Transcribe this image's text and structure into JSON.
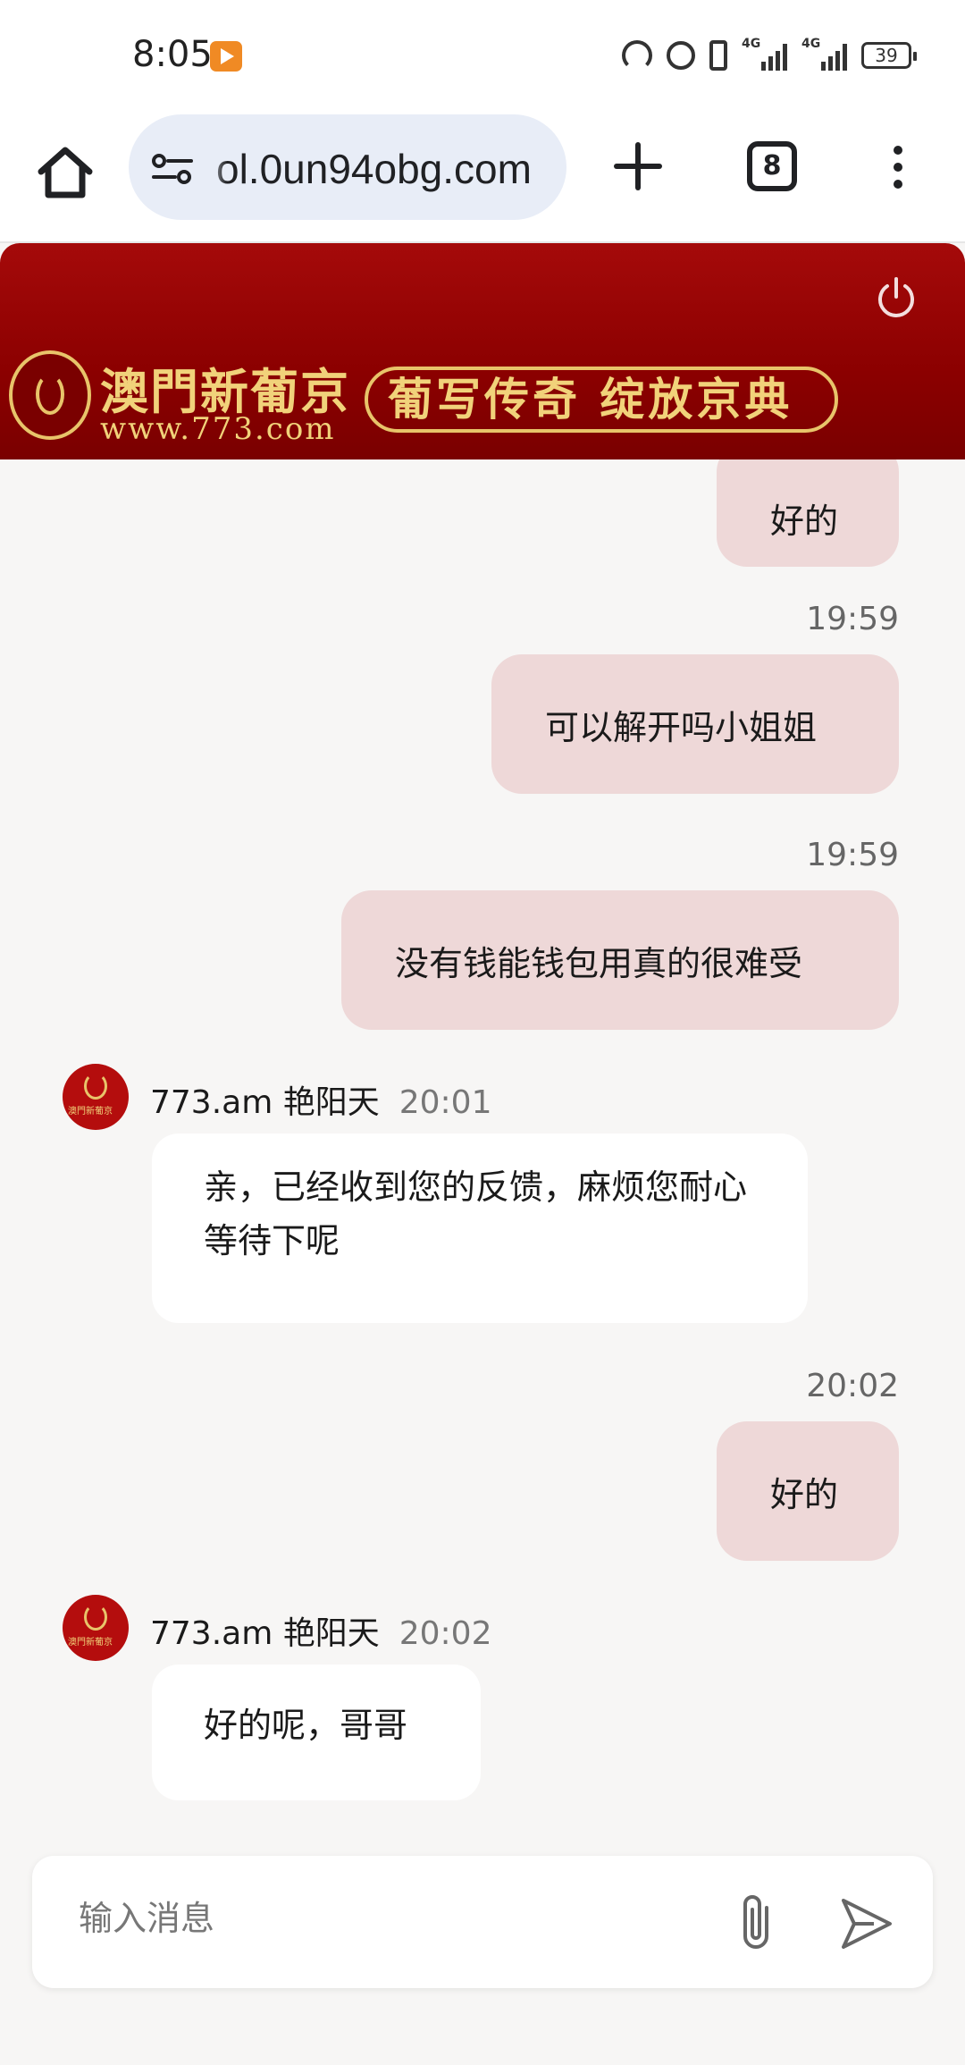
{
  "status_bar": {
    "time": "8:05",
    "signal_labels": [
      "4G",
      "4G"
    ],
    "battery": "39"
  },
  "browser": {
    "url": "ol.0un94obg.com",
    "tab_count": "8"
  },
  "banner": {
    "brand_name": "澳門新葡京",
    "brand_url": "www.773.com",
    "slogan": "葡写传奇 绽放京典"
  },
  "chat": {
    "messages": [
      {
        "direction": "out",
        "text": "好的"
      },
      {
        "direction": "out",
        "time": "19:59",
        "text": "可以解开吗小姐姐"
      },
      {
        "direction": "out",
        "time": "19:59",
        "text": "没有钱能钱包用真的很难受"
      },
      {
        "direction": "in",
        "sender": "773.am 艳阳天",
        "time": "20:01",
        "text": "亲，已经收到您的反馈，麻烦您耐心等待下呢"
      },
      {
        "direction": "out",
        "time": "20:02",
        "text": "好的"
      },
      {
        "direction": "in",
        "sender": "773.am 艳阳天",
        "time": "20:02",
        "text": "好的呢，哥哥"
      }
    ]
  },
  "composer": {
    "placeholder": "输入消息"
  },
  "icons": {
    "home": "home-icon",
    "site_settings": "tune-icon",
    "new_tab": "plus-icon",
    "tabs": "tab-switcher-icon",
    "menu": "more-vert-icon",
    "logout": "power-icon",
    "attach": "paperclip-icon",
    "send": "send-icon"
  },
  "colors": {
    "banner": "#8b0000",
    "outgoing_bubble": "#eed8d8",
    "incoming_bubble": "#ffffff",
    "chat_background": "#f7f6f5",
    "gold": "#f1d27a"
  }
}
